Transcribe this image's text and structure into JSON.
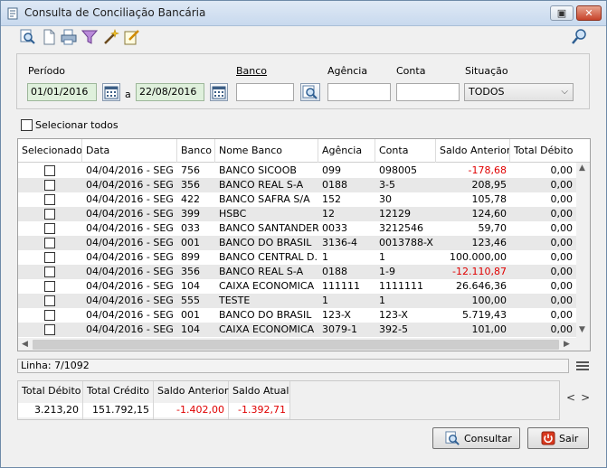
{
  "window": {
    "title": "Consulta de Conciliação Bancária",
    "controls": [
      "restore",
      "close"
    ]
  },
  "toolbar": {
    "icons": [
      "magnify-report-icon",
      "new-document-icon",
      "print-icon",
      "filter-icon",
      "wand-icon",
      "edit-icon",
      "search-key-icon"
    ]
  },
  "filters": {
    "periodo_label": "Período",
    "date_from": "01/01/2016",
    "date_sep": "a",
    "date_to": "22/08/2016",
    "banco_label": "Banco",
    "banco_value": "",
    "agencia_label": "Agência",
    "agencia_value": "",
    "conta_label": "Conta",
    "conta_value": "",
    "situacao_label": "Situação",
    "situacao_value": "TODOS"
  },
  "select_all": {
    "label": "Selecionar todos",
    "checked": false
  },
  "grid": {
    "columns": [
      "Selecionado",
      "Data",
      "Banco",
      "Nome Banco",
      "Agência",
      "Conta",
      "Saldo Anterior",
      "Total Débito"
    ],
    "rows": [
      {
        "data": "04/04/2016 - SEG",
        "banco": "756",
        "nome": "BANCO SICOOB",
        "agencia": "099",
        "conta": "098005",
        "saldo": "-178,68",
        "debito": "0,00",
        "neg": true
      },
      {
        "data": "04/04/2016 - SEG",
        "banco": "356",
        "nome": "BANCO REAL S-A",
        "agencia": "0188",
        "conta": "3-5",
        "saldo": "208,95",
        "debito": "0,00",
        "neg": false
      },
      {
        "data": "04/04/2016 - SEG",
        "banco": "422",
        "nome": "BANCO SAFRA S/A",
        "agencia": "152",
        "conta": "30",
        "saldo": "105,78",
        "debito": "0,00",
        "neg": false
      },
      {
        "data": "04/04/2016 - SEG",
        "banco": "399",
        "nome": "HSBC",
        "agencia": "12",
        "conta": "12129",
        "saldo": "124,60",
        "debito": "0,00",
        "neg": false
      },
      {
        "data": "04/04/2016 - SEG",
        "banco": "033",
        "nome": "BANCO SANTANDER",
        "agencia": "0033",
        "conta": "3212546",
        "saldo": "59,70",
        "debito": "0,00",
        "neg": false
      },
      {
        "data": "04/04/2016 - SEG",
        "banco": "001",
        "nome": "BANCO DO BRASIL",
        "agencia": "3136-4",
        "conta": "0013788-X",
        "saldo": "123,46",
        "debito": "0,00",
        "neg": false
      },
      {
        "data": "04/04/2016 - SEG",
        "banco": "899",
        "nome": "BANCO CENTRAL D...",
        "agencia": "1",
        "conta": "1",
        "saldo": "100.000,00",
        "debito": "0,00",
        "neg": false
      },
      {
        "data": "04/04/2016 - SEG",
        "banco": "356",
        "nome": "BANCO REAL S-A",
        "agencia": "0188",
        "conta": "1-9",
        "saldo": "-12.110,87",
        "debito": "0,00",
        "neg": true
      },
      {
        "data": "04/04/2016 - SEG",
        "banco": "104",
        "nome": "CAIXA ECONOMICA",
        "agencia": "111111",
        "conta": "1111111",
        "saldo": "26.646,36",
        "debito": "0,00",
        "neg": false
      },
      {
        "data": "04/04/2016 - SEG",
        "banco": "555",
        "nome": "TESTE",
        "agencia": "1",
        "conta": "1",
        "saldo": "100,00",
        "debito": "0,00",
        "neg": false
      },
      {
        "data": "04/04/2016 - SEG",
        "banco": "001",
        "nome": "BANCO DO BRASIL",
        "agencia": "123-X",
        "conta": "123-X",
        "saldo": "5.719,43",
        "debito": "0,00",
        "neg": false
      },
      {
        "data": "04/04/2016 - SEG",
        "banco": "104",
        "nome": "CAIXA ECONOMICA",
        "agencia": "3079-1",
        "conta": "392-5",
        "saldo": "101,00",
        "debito": "0,00",
        "neg": false
      }
    ]
  },
  "status": {
    "linha": "Linha: 7/1092"
  },
  "totals": {
    "headers": [
      "Total Débito",
      "Total Crédito",
      "Saldo Anterior",
      "Saldo Atual"
    ],
    "values": [
      "3.213,20",
      "151.792,15",
      "-1.402,00",
      "-1.392,71"
    ],
    "neg": [
      false,
      false,
      true,
      true
    ]
  },
  "nav": {
    "prev": "<",
    "next": ">"
  },
  "buttons": {
    "consultar": "Consultar",
    "sair": "Sair"
  },
  "colors": {
    "negative": "#e00000",
    "date_field_bg": "#dff0dc",
    "alt_row": "#e8e8e8"
  }
}
